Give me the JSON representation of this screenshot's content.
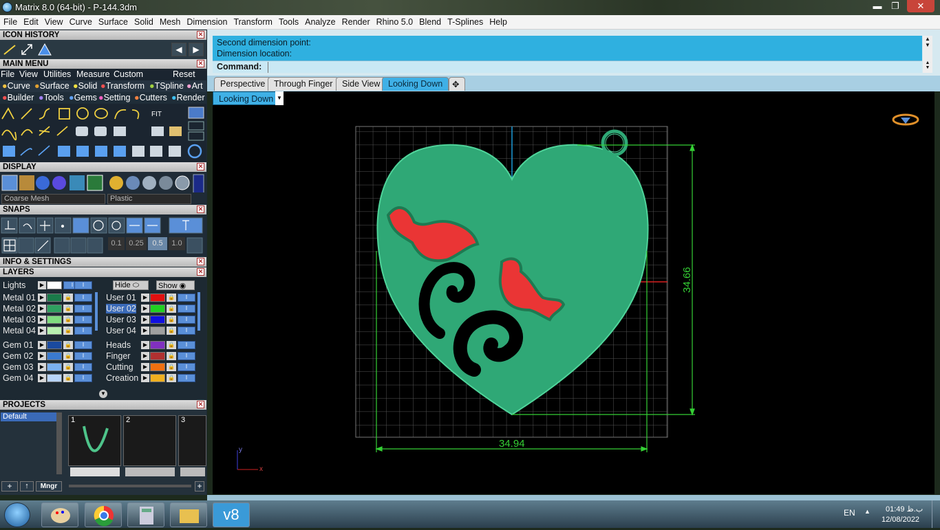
{
  "window": {
    "title": "Matrix 8.0 (64-bit) - P-144.3dm",
    "min": "▬",
    "max": "❐",
    "close": "✕"
  },
  "menu": [
    "File",
    "Edit",
    "View",
    "Curve",
    "Surface",
    "Solid",
    "Mesh",
    "Dimension",
    "Transform",
    "Tools",
    "Analyze",
    "Render",
    "Rhino 5.0",
    "Blend",
    "T-Splines",
    "Help"
  ],
  "panel": {
    "icon_history": "ICON HISTORY",
    "main_menu": "MAIN MENU",
    "main_menu_items": [
      "File",
      "View",
      "Utilities",
      "Measure",
      "Custom"
    ],
    "reset": "Reset",
    "categories1": [
      "Curve",
      "Surface",
      "Solid",
      "Transform",
      "TSpline",
      "Art"
    ],
    "categories2": [
      "Builder",
      "Tools",
      "Gems",
      "Setting",
      "Cutters",
      "Render"
    ],
    "fit": "FIT",
    "display": "DISPLAY",
    "mesh_select": "Coarse Mesh",
    "material_select": "Plastic",
    "snaps": "SNAPS",
    "snap_values": [
      "0.1",
      "0.25",
      "0.5",
      "1.0"
    ],
    "info_settings": "INFO & SETTINGS",
    "layers": "LAYERS",
    "lights": "Lights",
    "hide": "Hide",
    "show": "Show",
    "layers_left": [
      {
        "name": "Metal 01",
        "color": "#1a7a4a"
      },
      {
        "name": "Metal 02",
        "color": "#2fa060"
      },
      {
        "name": "Metal 03",
        "color": "#7fdc7f"
      },
      {
        "name": "Metal 04",
        "color": "#b8f0b0"
      },
      {
        "name": "Gem 01",
        "color": "#1a4aa0"
      },
      {
        "name": "Gem 02",
        "color": "#3a7ad0"
      },
      {
        "name": "Gem 03",
        "color": "#7ab0f0"
      },
      {
        "name": "Gem 04",
        "color": "#b8d4f8"
      }
    ],
    "layers_right": [
      {
        "name": "User 01",
        "color": "#e01010"
      },
      {
        "name": "User 02",
        "color": "#20d020"
      },
      {
        "name": "User 03",
        "color": "#1010e0"
      },
      {
        "name": "User 04",
        "color": "#a0a0a0"
      },
      {
        "name": "Heads",
        "color": "#8030c0"
      },
      {
        "name": "Finger",
        "color": "#b03030"
      },
      {
        "name": "Cutting",
        "color": "#f07010"
      },
      {
        "name": "Creation",
        "color": "#f0b020"
      }
    ],
    "projects": "PROJECTS",
    "project_default": "Default",
    "slots": [
      "1",
      "2",
      "3"
    ],
    "mngr": "Mngr"
  },
  "command": {
    "line1": "Second dimension point:",
    "line2": "Dimension location:",
    "prompt": "Command:"
  },
  "tabs": [
    "Perspective",
    "Through Finger",
    "Side View",
    "Looking Down"
  ],
  "active_tab": "Looking Down",
  "viewport": {
    "label": "Looking Down",
    "dim_h": "34.94",
    "dim_v": "34.66",
    "axis_y": "y",
    "axis_x": "x"
  },
  "colors": {
    "metal": "#2fa876",
    "gem": "#ea3535",
    "dim": "#35d035"
  },
  "taskbar": {
    "lang": "EN",
    "time": "01:49 ب.ظ",
    "date": "12/08/2022",
    "v8": "v8"
  }
}
